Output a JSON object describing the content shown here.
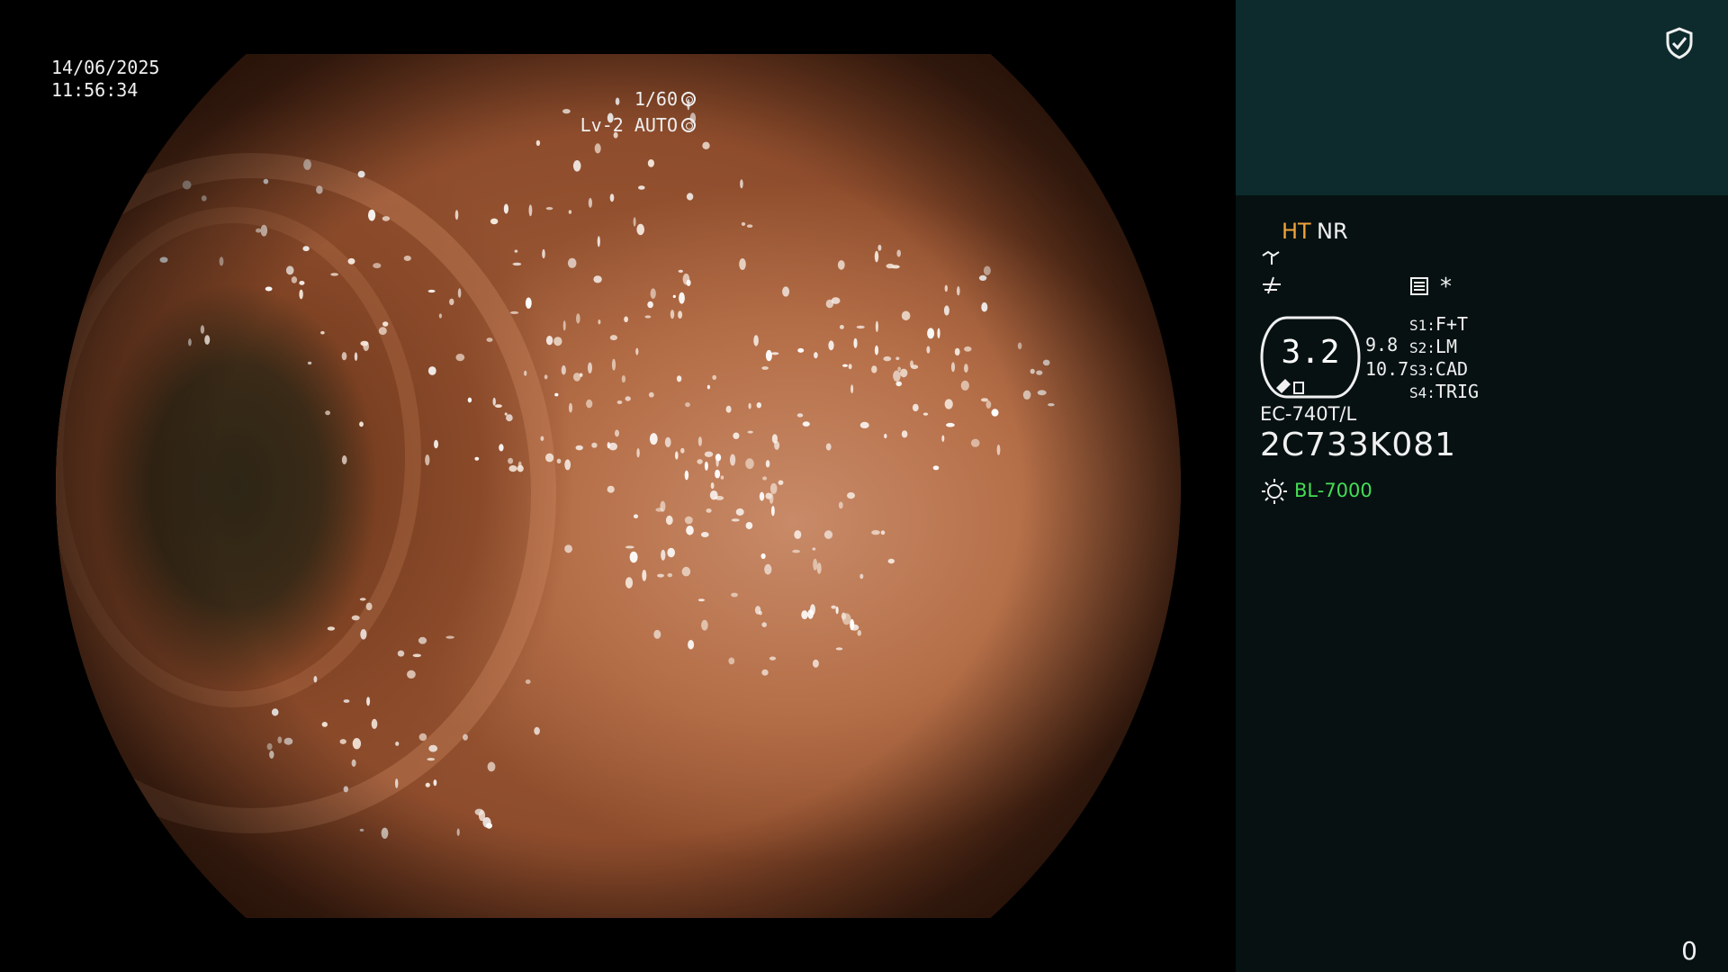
{
  "osd": {
    "date": "14/06/2025",
    "time": "11:56:34",
    "shutter": "1/60",
    "level": "Lv-2 AUTO"
  },
  "panel": {
    "ht": "HT",
    "nr": "NR",
    "asterisk": "*",
    "zoom": "3.2",
    "value_a": "9.8",
    "value_b": "10.7",
    "switches": [
      {
        "key": "S1:",
        "value": "F+T"
      },
      {
        "key": "S2:",
        "value": "LM"
      },
      {
        "key": "S3:",
        "value": "CAD"
      },
      {
        "key": "S4:",
        "value": "TRIG"
      }
    ],
    "scope_model": "EC-740T/L",
    "scope_serial": "2C733K081",
    "light_source": "BL-7000",
    "counter": "0"
  },
  "colors": {
    "ht": "#f0a23a",
    "light_source": "#44dd55",
    "panel_top": "#0d2a2c",
    "panel_bg": "#071112"
  },
  "icons": [
    "shield-check-icon",
    "waveform-icon",
    "menu-icon",
    "light-source-icon",
    "iris-icon"
  ]
}
